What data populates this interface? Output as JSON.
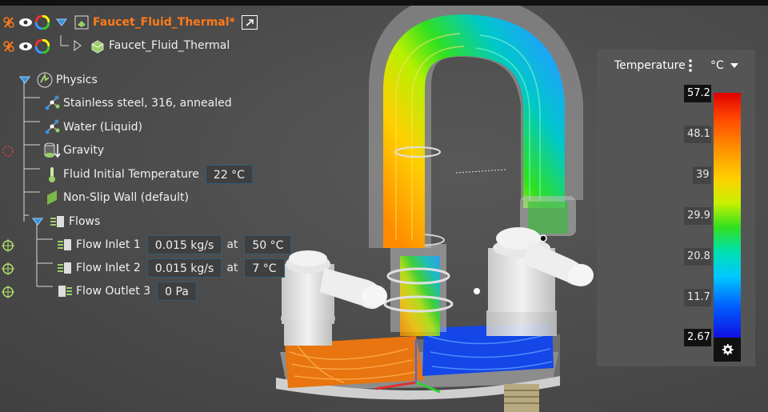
{
  "colors": {
    "accent_orange": "#ff7a1a",
    "field_border": "#2f5d7c",
    "link_blue": "#3a8fd9"
  },
  "header": {
    "assembly_name": "Faucet_Fluid_Thermal*",
    "part_name": "Faucet_Fluid_Thermal"
  },
  "tree": {
    "physics_label": "Physics",
    "material_solid": "Stainless steel, 316, annealed",
    "material_fluid": "Water (Liquid)",
    "gravity": "Gravity",
    "initial_temp_label": "Fluid Initial Temperature",
    "initial_temp_value": "22 °C",
    "wall": "Non-Slip Wall (default)",
    "flows_label": "Flows",
    "inlet1": {
      "label": "Flow Inlet 1",
      "rate": "0.015 kg/s",
      "at": "at",
      "temp": "50 °C"
    },
    "inlet2": {
      "label": "Flow Inlet 2",
      "rate": "0.015 kg/s",
      "at": "at",
      "temp": "7 °C"
    },
    "outlet3": {
      "label": "Flow Outlet 3",
      "pressure": "0 Pa"
    }
  },
  "legend": {
    "title": "Temperature",
    "unit": "°C",
    "max": "57.2",
    "ticks": [
      "48.1",
      "39",
      "29.9",
      "20.8",
      "11.7"
    ],
    "min": "2.67"
  }
}
